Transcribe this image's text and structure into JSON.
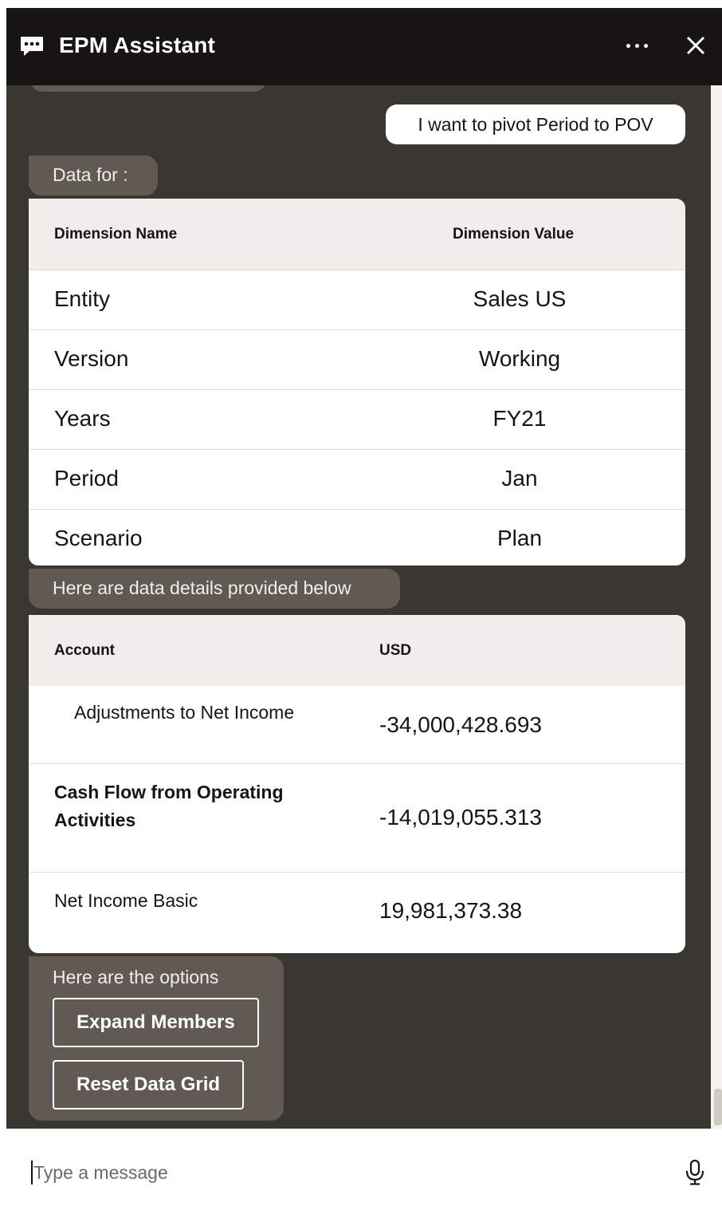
{
  "header": {
    "title": "EPM Assistant",
    "more_icon": "more-horizontal-icon",
    "close_icon": "close-icon"
  },
  "conversation": {
    "user_message": "I want to pivot Period to POV",
    "pov_intro": "Data for :",
    "pov_table": {
      "headers": [
        "Dimension Name",
        "Dimension Value"
      ],
      "rows": [
        [
          "Entity",
          "Sales US"
        ],
        [
          "Version",
          "Working"
        ],
        [
          "Years",
          "FY21"
        ],
        [
          "Period",
          "Jan"
        ],
        [
          "Scenario",
          "Plan"
        ]
      ]
    },
    "data_intro": "Here are data details provided below",
    "data_table": {
      "headers": [
        "Account",
        "USD"
      ],
      "rows": [
        [
          "Adjustments to Net Income",
          "-34,000,428.693"
        ],
        [
          "Cash Flow from Operating Activities",
          "-14,019,055.313"
        ],
        [
          "Net Income Basic",
          "19,981,373.38"
        ]
      ]
    },
    "options_intro": "Here are the options",
    "options": [
      "Expand Members",
      "Reset Data Grid"
    ]
  },
  "composer": {
    "placeholder": "Type a message",
    "mic_icon": "microphone-icon"
  },
  "colors": {
    "header_bg": "#161513",
    "conversation_bg": "#3a3631",
    "bot_bubble": "#615a53",
    "table_header_bg": "#efeeeb"
  }
}
